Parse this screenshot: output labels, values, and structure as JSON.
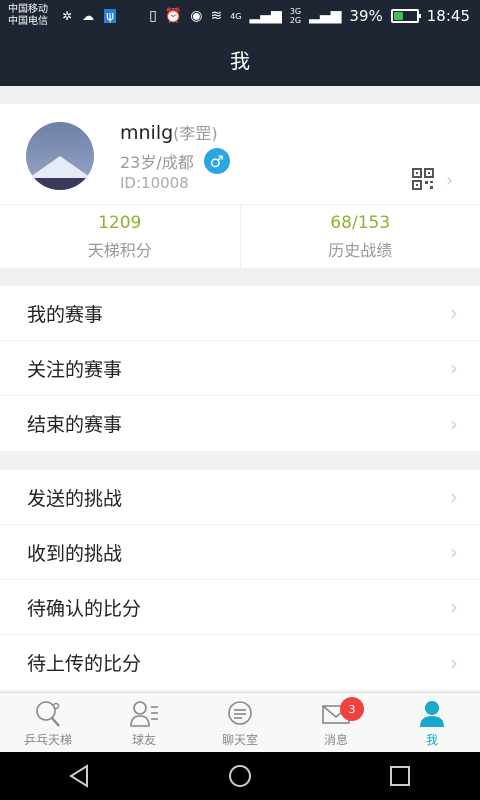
{
  "status": {
    "carrier1": "中国移动",
    "carrier2": "中国电信",
    "battery_pct": "39%",
    "time": "18:45",
    "net1": "4G",
    "net2": "3G",
    "net3": "2G",
    "battery_level": 0.39
  },
  "title": "我",
  "profile": {
    "nickname": "mnilg",
    "realname": "(李罡)",
    "age_city": "23岁/成都",
    "gender_symbol": "♂",
    "id": "ID:10008"
  },
  "stats": [
    {
      "value": "1209",
      "label": "天梯积分"
    },
    {
      "value": "68/153",
      "label": "历史战绩"
    }
  ],
  "group1": [
    "我的赛事",
    "关注的赛事",
    "结束的赛事"
  ],
  "group2": [
    "发送的挑战",
    "收到的挑战",
    "待确认的比分",
    "待上传的比分"
  ],
  "tabs": [
    {
      "label": "乒乓天梯",
      "icon": "pingpong-paddle-icon"
    },
    {
      "label": "球友",
      "icon": "friends-icon"
    },
    {
      "label": "聊天室",
      "icon": "chat-icon"
    },
    {
      "label": "消息",
      "icon": "message-icon",
      "badge": "3"
    },
    {
      "label": "我",
      "icon": "user-icon",
      "active": true
    }
  ],
  "colors": {
    "header_bg": "#1f2633",
    "accent_green": "#8ab32e",
    "tab_active": "#17a9c9",
    "gender_blue": "#2aa6e4",
    "badge_red": "#f04040"
  }
}
